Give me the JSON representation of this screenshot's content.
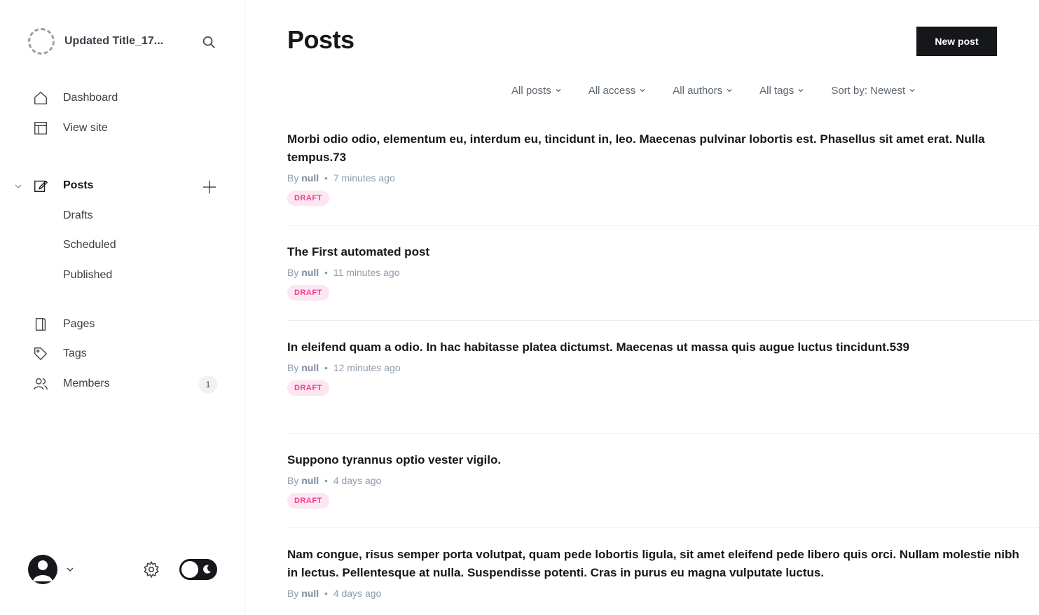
{
  "sidebar": {
    "site_title": "Updated Title_17...",
    "nav": {
      "dashboard": "Dashboard",
      "view_site": "View site",
      "posts": "Posts",
      "drafts": "Drafts",
      "scheduled": "Scheduled",
      "published": "Published",
      "pages": "Pages",
      "tags": "Tags",
      "members": "Members",
      "members_count": "1"
    }
  },
  "header": {
    "title": "Posts",
    "new_post_label": "New post"
  },
  "filters": {
    "posts": "All posts",
    "access": "All access",
    "authors": "All authors",
    "tags": "All tags",
    "sort": "Sort by: Newest"
  },
  "posts": [
    {
      "title": "Morbi odio odio, elementum eu, interdum eu, tincidunt in, leo. Maecenas pulvinar lobortis est. Phasellus sit amet erat. Nulla tempus.73",
      "by": "By",
      "author": "null",
      "time": "7 minutes ago",
      "status": "DRAFT"
    },
    {
      "title": "The First automated post",
      "by": "By",
      "author": "null",
      "time": "11 minutes ago",
      "status": "DRAFT"
    },
    {
      "title": "In eleifend quam a odio. In hac habitasse platea dictumst. Maecenas ut massa quis augue luctus tincidunt.539",
      "by": "By",
      "author": "null",
      "time": "12 minutes ago",
      "status": "DRAFT"
    },
    {
      "title": "Suppono tyrannus optio vester vigilo.",
      "by": "By",
      "author": "null",
      "time": "4 days ago",
      "status": "DRAFT"
    },
    {
      "title": "Nam congue, risus semper porta volutpat, quam pede lobortis ligula, sit amet eleifend pede libero quis orci. Nullam molestie nibh in lectus. Pellentesque at nulla. Suspendisse potenti. Cras in purus eu magna vulputate luctus.",
      "by": "By",
      "author": "null",
      "time": "4 days ago"
    }
  ],
  "colors": {
    "accent": "#15171a",
    "draft_bg": "#fde5f1",
    "draft_text": "#f33b93"
  }
}
